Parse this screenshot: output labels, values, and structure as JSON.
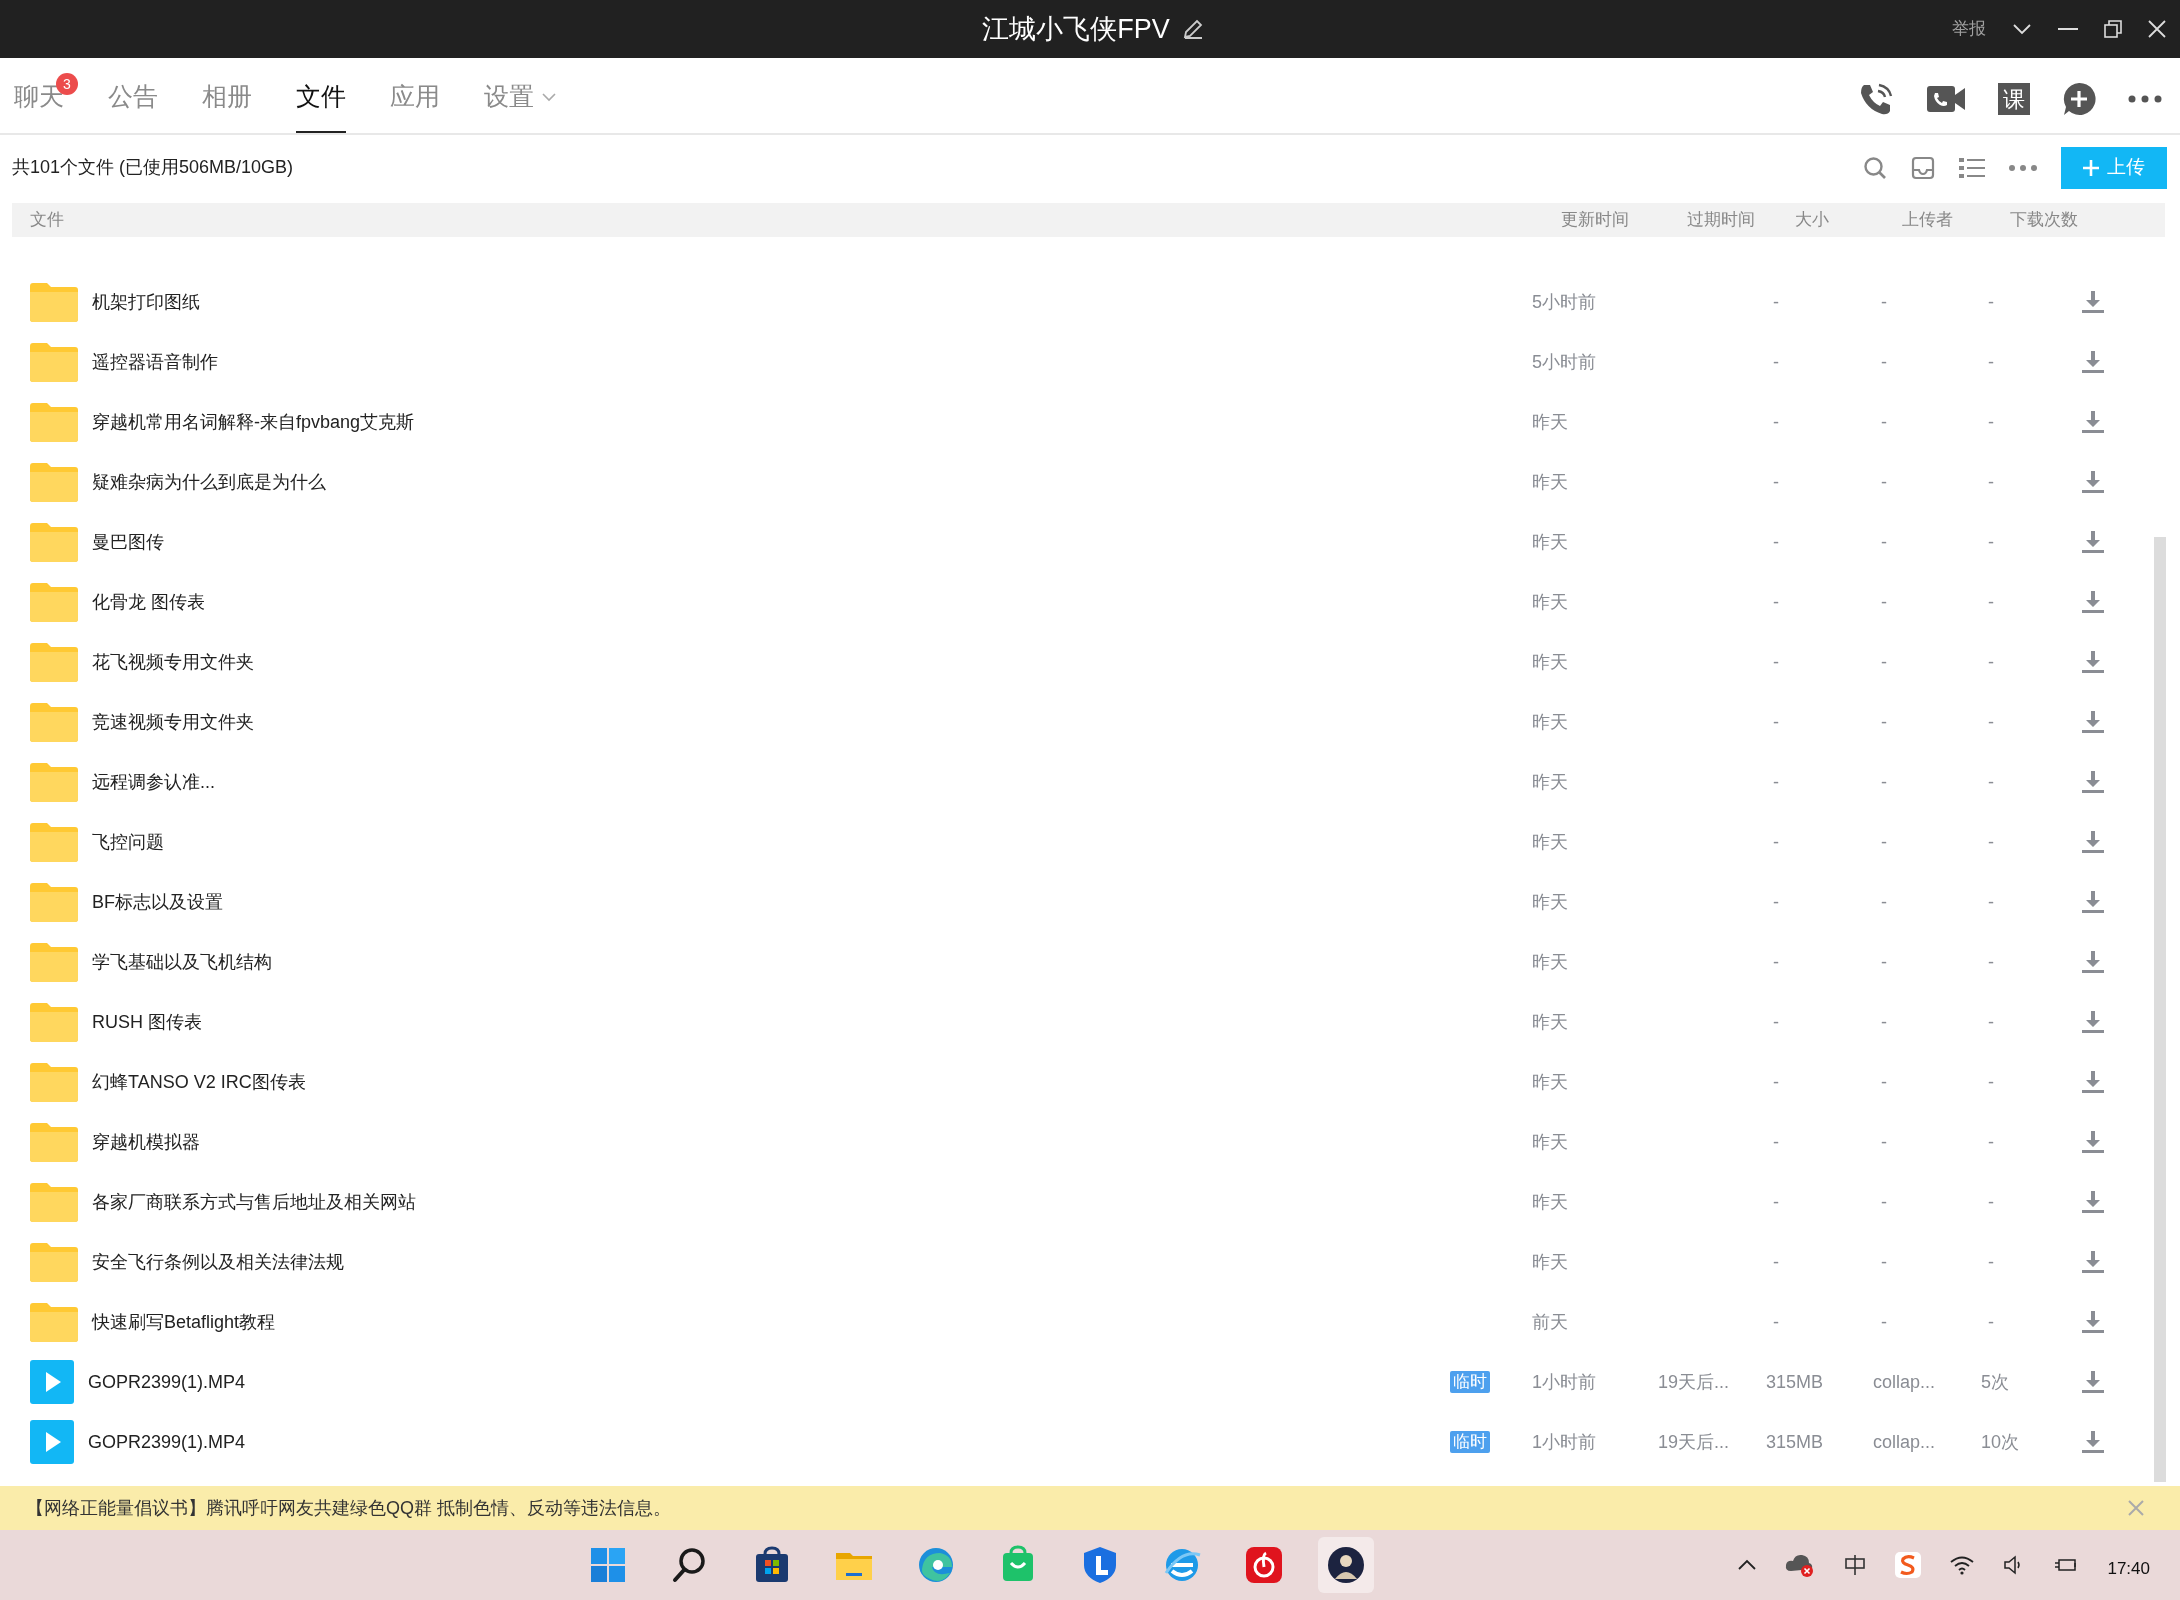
{
  "window": {
    "title": "江城小飞侠FPV",
    "report": "举报"
  },
  "tabs": [
    {
      "label": "聊天",
      "selected": false,
      "badge": "3",
      "dropdown": false
    },
    {
      "label": "公告",
      "selected": false,
      "dropdown": false
    },
    {
      "label": "相册",
      "selected": false,
      "dropdown": false
    },
    {
      "label": "文件",
      "selected": true,
      "dropdown": false
    },
    {
      "label": "应用",
      "selected": false,
      "dropdown": false
    },
    {
      "label": "设置",
      "selected": false,
      "dropdown": true
    }
  ],
  "header_actions": {
    "course": "课"
  },
  "toolbar": {
    "summary": "共101个文件 (已使用506MB/10GB)",
    "upload": "上传"
  },
  "table": {
    "columns": [
      "文件",
      "更新时间",
      "过期时间",
      "大小",
      "上传者",
      "下载次数"
    ],
    "rows": [
      {
        "kind": "folder",
        "name": "机架打印图纸",
        "updated": "5小时前",
        "size": "-",
        "uploader": "-",
        "downloads": "-"
      },
      {
        "kind": "folder",
        "name": "遥控器语音制作",
        "updated": "5小时前",
        "size": "-",
        "uploader": "-",
        "downloads": "-"
      },
      {
        "kind": "folder",
        "name": "穿越机常用名词解释-来自fpvbang艾克斯",
        "updated": "昨天",
        "size": "-",
        "uploader": "-",
        "downloads": "-"
      },
      {
        "kind": "folder",
        "name": "疑难杂病为什么到底是为什么",
        "updated": "昨天",
        "size": "-",
        "uploader": "-",
        "downloads": "-"
      },
      {
        "kind": "folder",
        "name": "曼巴图传",
        "updated": "昨天",
        "size": "-",
        "uploader": "-",
        "downloads": "-"
      },
      {
        "kind": "folder",
        "name": "化骨龙 图传表",
        "updated": "昨天",
        "size": "-",
        "uploader": "-",
        "downloads": "-"
      },
      {
        "kind": "folder",
        "name": "花飞视频专用文件夹",
        "updated": "昨天",
        "size": "-",
        "uploader": "-",
        "downloads": "-"
      },
      {
        "kind": "folder",
        "name": "竞速视频专用文件夹",
        "updated": "昨天",
        "size": "-",
        "uploader": "-",
        "downloads": "-"
      },
      {
        "kind": "folder",
        "name": "远程调参认准...",
        "updated": "昨天",
        "size": "-",
        "uploader": "-",
        "downloads": "-"
      },
      {
        "kind": "folder",
        "name": "飞控问题",
        "updated": "昨天",
        "size": "-",
        "uploader": "-",
        "downloads": "-"
      },
      {
        "kind": "folder",
        "name": "BF标志以及设置",
        "updated": "昨天",
        "size": "-",
        "uploader": "-",
        "downloads": "-"
      },
      {
        "kind": "folder",
        "name": "学飞基础以及飞机结构",
        "updated": "昨天",
        "size": "-",
        "uploader": "-",
        "downloads": "-"
      },
      {
        "kind": "folder",
        "name": "RUSH 图传表",
        "updated": "昨天",
        "size": "-",
        "uploader": "-",
        "downloads": "-"
      },
      {
        "kind": "folder",
        "name": "幻蜂TANSO V2 IRC图传表",
        "updated": "昨天",
        "size": "-",
        "uploader": "-",
        "downloads": "-"
      },
      {
        "kind": "folder",
        "name": "穿越机模拟器",
        "updated": "昨天",
        "size": "-",
        "uploader": "-",
        "downloads": "-"
      },
      {
        "kind": "folder",
        "name": "各家厂商联系方式与售后地址及相关网站",
        "updated": "昨天",
        "size": "-",
        "uploader": "-",
        "downloads": "-"
      },
      {
        "kind": "folder",
        "name": "安全飞行条例以及相关法律法规",
        "updated": "昨天",
        "size": "-",
        "uploader": "-",
        "downloads": "-"
      },
      {
        "kind": "folder",
        "name": "快速刷写Betaflight教程",
        "updated": "前天",
        "size": "-",
        "uploader": "-",
        "downloads": "-"
      },
      {
        "kind": "video",
        "name": "GOPR2399(1).MP4",
        "tag": "临时",
        "updated": "1小时前",
        "expires": "19天后...",
        "size": "315MB",
        "uploader": "collap...",
        "downloads": "5次"
      },
      {
        "kind": "video",
        "name": "GOPR2399(1).MP4",
        "tag": "临时",
        "updated": "1小时前",
        "expires": "19天后...",
        "size": "315MB",
        "uploader": "collap...",
        "downloads": "10次"
      }
    ]
  },
  "notice": "【网络正能量倡议书】腾讯呼吁网友共建绿色QQ群 抵制色情、反动等违法信息。",
  "taskbar": {
    "time": "17:40"
  }
}
